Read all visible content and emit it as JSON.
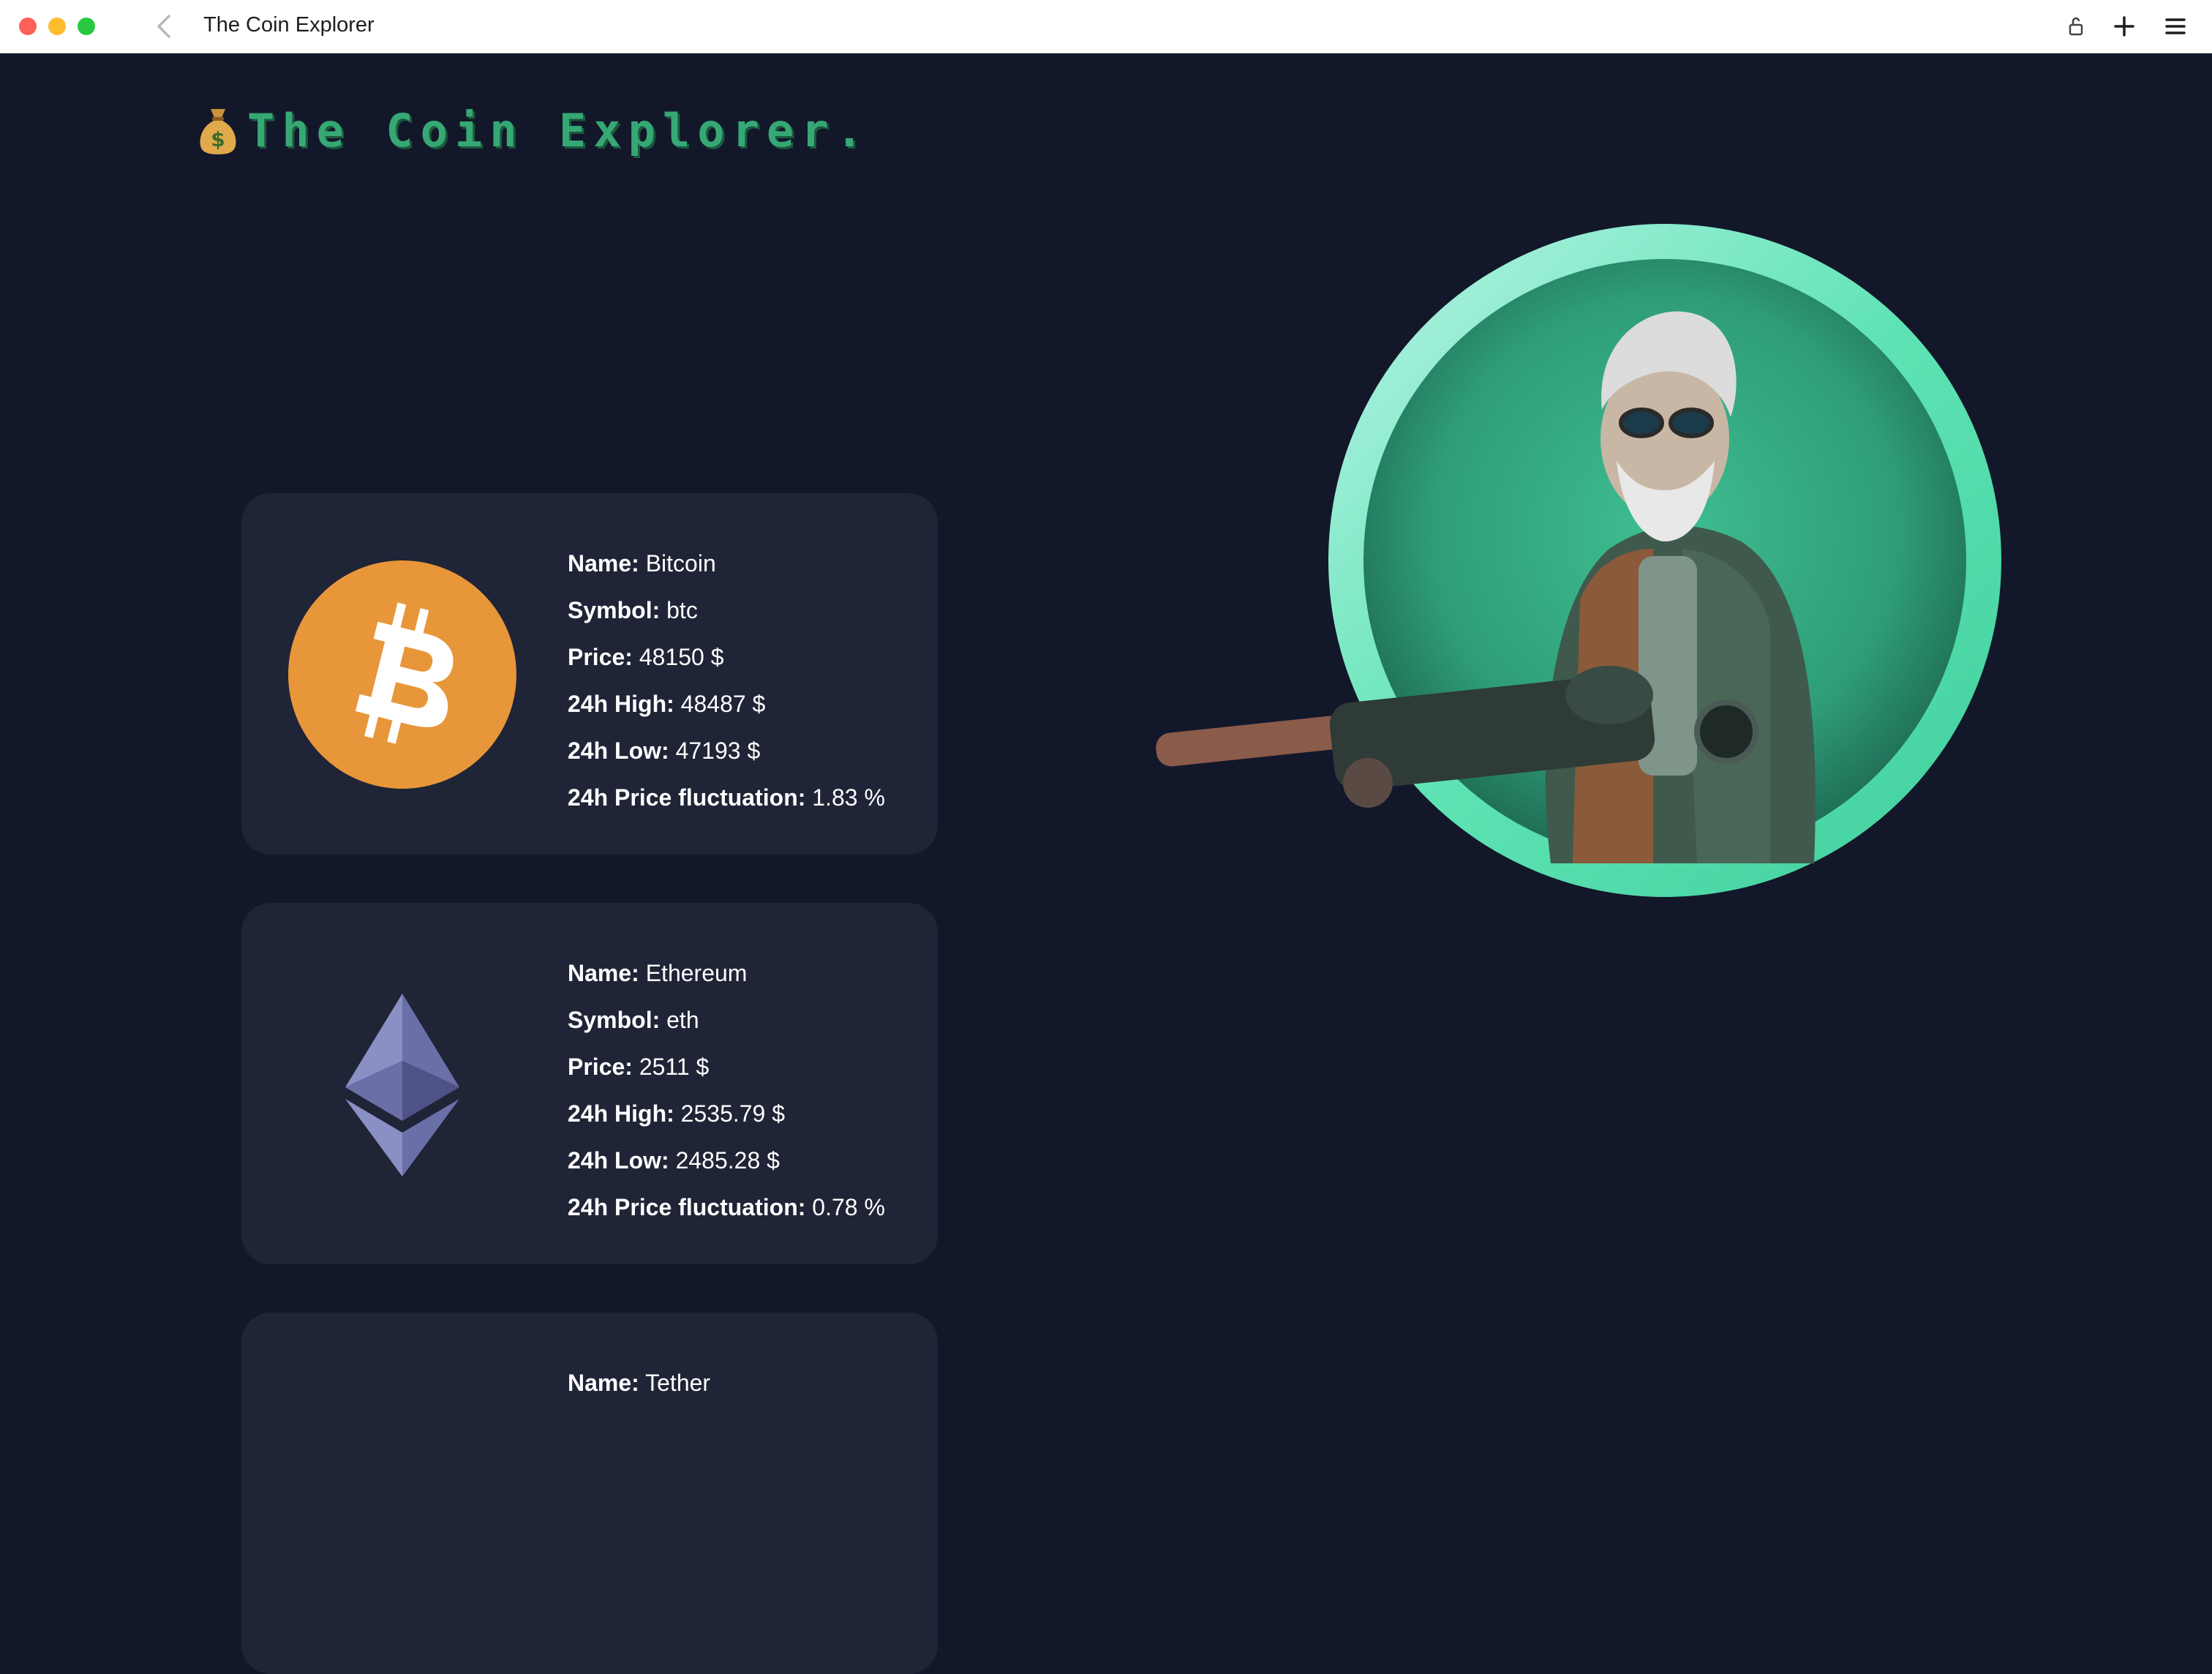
{
  "window": {
    "title": "The Coin Explorer"
  },
  "header": {
    "title": "The Coin Explorer."
  },
  "coins": [
    {
      "name_label": "Name:",
      "name": "Bitcoin",
      "symbol_label": "Symbol:",
      "symbol": "btc",
      "price_label": "Price:",
      "price": "48150 $",
      "high_label": "24h High:",
      "high": "48487 $",
      "low_label": "24h Low:",
      "low": "47193 $",
      "fluct_label": "24h Price fluctuation:",
      "fluct": "1.83 %",
      "icon": "bitcoin-icon",
      "color": "#e8963a"
    },
    {
      "name_label": "Name:",
      "name": "Ethereum",
      "symbol_label": "Symbol:",
      "symbol": "eth",
      "price_label": "Price:",
      "price": "2511 $",
      "high_label": "24h High:",
      "high": "2535.79 $",
      "low_label": "24h Low:",
      "low": "2485.28 $",
      "fluct_label": "24h Price fluctuation:",
      "fluct": "0.78 %",
      "icon": "ethereum-icon",
      "color": "#8a8fc4"
    },
    {
      "name_label": "Name:",
      "name": "Tether",
      "icon": "tether-icon"
    }
  ],
  "colors": {
    "background": "#13172a",
    "card": "#1f2436",
    "title_green": "#36a874",
    "hero_ring": "#5fe3b4"
  }
}
